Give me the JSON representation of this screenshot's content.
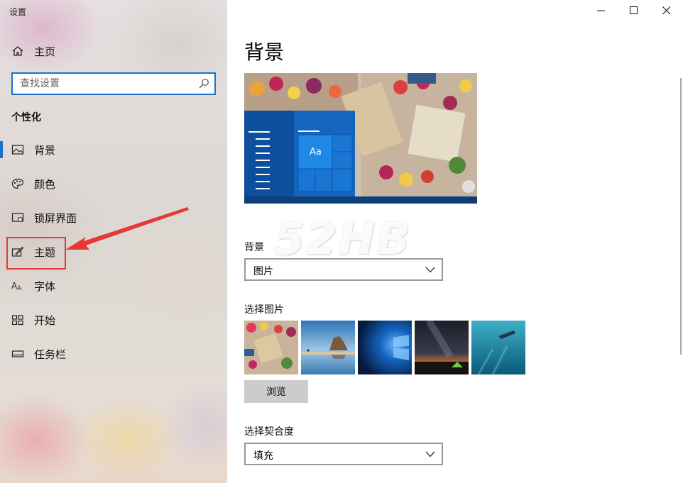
{
  "window": {
    "title": "设置"
  },
  "sidebar": {
    "home_label": "主页",
    "search_placeholder": "查找设置",
    "section_title": "个性化",
    "items": [
      {
        "label": "背景",
        "icon": "image-icon",
        "active": true
      },
      {
        "label": "颜色",
        "icon": "palette-icon"
      },
      {
        "label": "锁屏界面",
        "icon": "lock-screen-icon"
      },
      {
        "label": "主题",
        "icon": "theme-brush-icon"
      },
      {
        "label": "字体",
        "icon": "font-icon"
      },
      {
        "label": "开始",
        "icon": "start-grid-icon"
      },
      {
        "label": "任务栏",
        "icon": "taskbar-icon"
      }
    ]
  },
  "main": {
    "title": "背景",
    "preview_tile_text": "Aa",
    "background_label": "背景",
    "background_value": "图片",
    "choose_picture_label": "选择图片",
    "thumbnails": [
      "food-table",
      "beach-rocks",
      "windows-logo",
      "night-sky",
      "underwater-diver"
    ],
    "browse_label": "浏览",
    "fit_label": "选择契合度",
    "fit_value": "填充"
  },
  "watermark": "52HB",
  "colors": {
    "accent": "#1a73c9",
    "annotation": "#e53935"
  }
}
